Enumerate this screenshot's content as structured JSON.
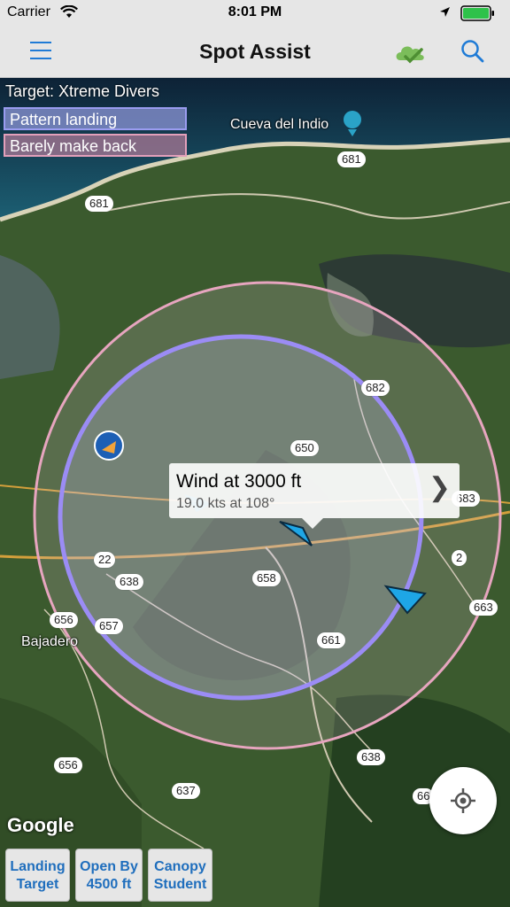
{
  "status_bar": {
    "carrier": "Carrier",
    "time": "8:01 PM"
  },
  "nav": {
    "title": "Spot Assist"
  },
  "map": {
    "target_label": "Target: Xtreme Divers",
    "legend": {
      "pattern": "Pattern landing",
      "barely": "Barely make back"
    },
    "place_labels": {
      "cueva": "Cueva del Indio",
      "bajadero": "Bajadero"
    },
    "roads": [
      "681",
      "681",
      "682",
      "650",
      "683",
      "22",
      "638",
      "658",
      "2",
      "656",
      "657",
      "663",
      "661",
      "638",
      "656",
      "637",
      "66"
    ],
    "wind_callout": {
      "title": "Wind at 3000 ft",
      "detail": "19.0 kts  at 108°"
    },
    "provider": "Google",
    "colors": {
      "pattern_circle": "#9b8cf5",
      "barely_circle": "#e7a5bf",
      "wind_arrow": "#1ea6e6"
    }
  },
  "toolbar": {
    "landing_target": [
      "Landing",
      "Target"
    ],
    "open_by": [
      "Open By",
      "4500 ft"
    ],
    "canopy": [
      "Canopy",
      "Student"
    ]
  }
}
